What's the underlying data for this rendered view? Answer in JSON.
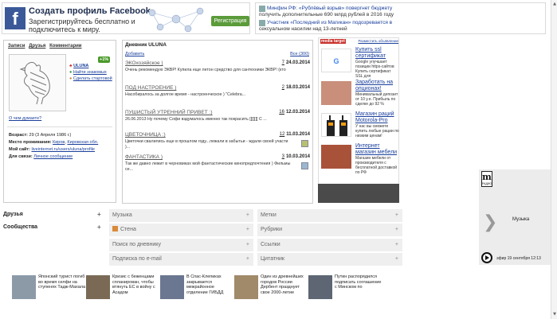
{
  "top_ads": {
    "facebook": {
      "logo": "f",
      "title": "Создать профиль Facebook",
      "subtitle": "Зарегистрируйтесь бесплатно и подключитесь к миру.",
      "button": "Регистрация"
    },
    "news": [
      {
        "source": "Минфин РФ: «Рублёвый взрыв» повергнет бюджету",
        "text": "получить дополнительные 690 млрд рублей в 2016 году"
      },
      {
        "source": "Участник «Последний из Магикан» подозревается в",
        "text": "сексуальном насилии над 13-летней"
      }
    ]
  },
  "profile": {
    "links": [
      "Записи",
      "Друзья",
      "Комментарии"
    ],
    "username": "ULUNA",
    "badge": "+1%",
    "actions": [
      "Найти знакомых",
      "Сделать стартовой"
    ],
    "mood": "О чем думаете?",
    "info": [
      {
        "label": "Возраст:",
        "value": "29 (3 Апреля 1986 г.)"
      },
      {
        "label": "Место проживания:",
        "value": "Киров",
        "value2": "Кировская обл."
      },
      {
        "label": "Мой сайт:",
        "value": "liveinternet.ru/users/uluna/profile"
      },
      {
        "label": "Для связи:",
        "value": "Личное сообщение"
      }
    ]
  },
  "diary": {
    "title": "Дневник ULUNA",
    "sub": "Добавить",
    "all": "Все (300)",
    "entries": [
      {
        "title": "ЭКОхозяйское )",
        "count": "7",
        "date": "24.03.2014",
        "text": "Очень рекомендую ЭКВР! Купила еще летон средство для сантехники ЭКВР! (кто"
      },
      {
        "title": "ПОД НАСТРОЕНИЕ )",
        "count": "2",
        "date": "18.03.2014",
        "text": "Насобиралось за долгое время - настроенческое ) \"Celebra..."
      },
      {
        "title": "ПУШИСТЫЙ УТРЕННИЙ ПРИВЕТ :)",
        "count": "16",
        "date": "12.03.2014",
        "text": "26.06.2013 Ну почему Софи вздумалось именно так покрасить [[[[[[[ С ..."
      },
      {
        "title": "ЦВЕТОЧНИЦА :)",
        "count": "12",
        "date": "11.03.2014",
        "text": "Цветочки свалились еще в прошлом году...лежали в забытьи - ждали своей участи )..."
      },
      {
        "title": "ФАНТАСТИКА )",
        "count": "3",
        "date": "10.03.2014",
        "text": "Так же давно лежит в черновиках мой фантастические кинопредпочтения ) Фильмы се..."
      }
    ]
  },
  "right_ad": {
    "network": "media target",
    "place_ad": "Разместить объявление",
    "items": [
      {
        "head": "Купить ssl сертификат",
        "body": "Google улучшает позиции https-сайтов Купить сертификат SSL для"
      },
      {
        "head": "Заработать на опционах!",
        "body": "Минимальный депозит от 10 у.е. Прибыль по сделке до 92 %"
      },
      {
        "head": "Магазин раций Motorola-Pro",
        "body": "У нас вы сможете купить любые рации по низким ценам!"
      },
      {
        "head": "Интернет магазин мебели",
        "body": "Магазин мебели от производителя с бесплатной доставкой по РФ"
      }
    ]
  },
  "radio": {
    "logo": "m",
    "logo_sub": "РАДИО",
    "now": "Музыка",
    "on_air": "эфир 19 сентября 12:13"
  },
  "sidebar": [
    "Друзья",
    "Сообщества"
  ],
  "tiles": [
    {
      "label": "Музыка",
      "col": 0
    },
    {
      "label": "Метки",
      "col": 1
    },
    {
      "label": "Стена",
      "col": 0,
      "icon": true
    },
    {
      "label": "Рубрики",
      "col": 1
    },
    {
      "label": "Поиск по дневнику",
      "col": 0
    },
    {
      "label": "Ссылки",
      "col": 1
    },
    {
      "label": "Подписка по e-mail",
      "col": 0
    },
    {
      "label": "Цитатник",
      "col": 1
    }
  ],
  "news": [
    {
      "text": "Японский турист погиб во время селфи на ступенях Тадж-Махала",
      "color": "#8c9aa8"
    },
    {
      "text": "Кризис с беженцами спланирован, чтобы втянуть ЕС в войну с Асадом",
      "color": "#7a6a55"
    },
    {
      "text": "В Спас-Клепиках закрывается межрайонное отделение ГИБДД",
      "color": "#6b7690"
    },
    {
      "text": "Один из древнейших городов России Дербент празднует свое 2000-летие",
      "color": "#a08a6a"
    },
    {
      "text": "Путин распорядился подписать соглашение с Минском по",
      "color": "#5d6672"
    }
  ],
  "colors": {
    "link": "#1a3f9c",
    "facebook": "#3b5998",
    "badge": "#4a9a2a",
    "tile": "#efefef"
  }
}
